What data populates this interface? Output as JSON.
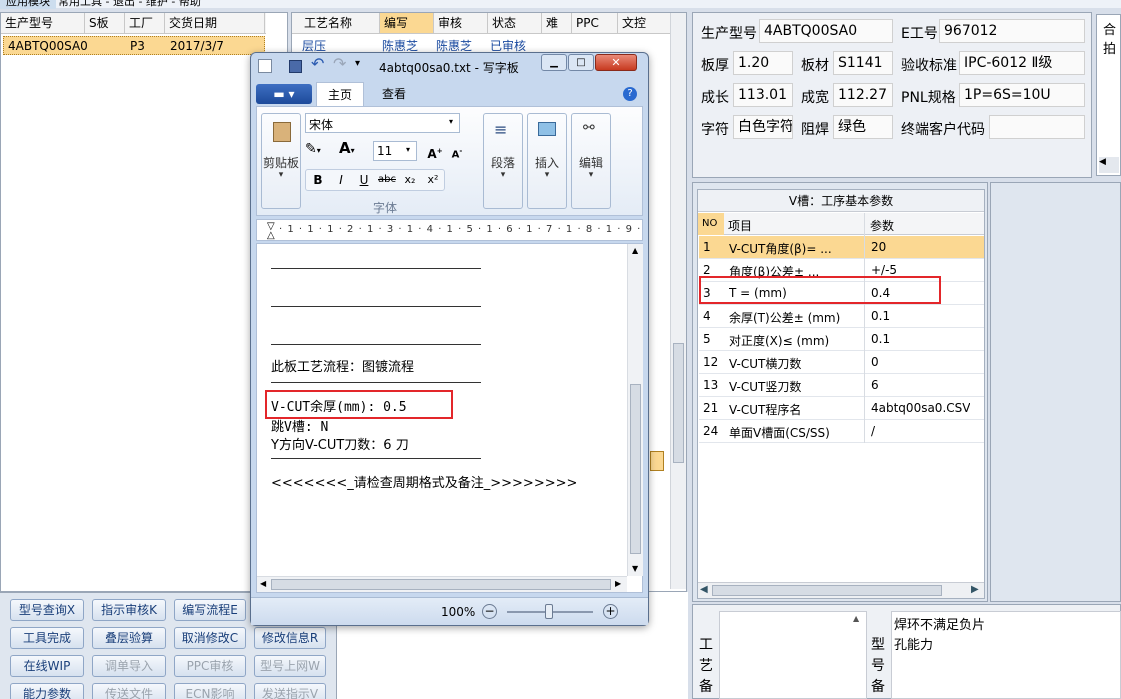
{
  "menubar": {
    "item1": "应用模块",
    "item2": "常用工具 - 退出 - 维护 - 帮助"
  },
  "left_list": {
    "headers": [
      "生产型号",
      "S板",
      "工厂",
      "交货日期"
    ],
    "row": {
      "model": "4ABTQ00SA0",
      "factory": "P3",
      "date": "2017/3/7"
    }
  },
  "middle_list": {
    "headers": [
      "工艺名称",
      "编写",
      "审核",
      "状态",
      "难",
      "PPC",
      "文控"
    ],
    "row": {
      "process": "层压",
      "writer": "陈惠芝",
      "auditor": "陈惠芝",
      "status": "已审核"
    }
  },
  "buttons": {
    "r1": [
      "型号查询X",
      "指示审核K",
      "编写流程E"
    ],
    "r2": [
      "工具完成",
      "叠层验算",
      "取消修改C",
      "修改信息R"
    ],
    "r3": [
      "在线WIP",
      "调单导入",
      "PPC审核",
      "型号上网W"
    ],
    "r4": [
      "能力参数",
      "传送文件",
      "ECN影响",
      "发送指示V"
    ]
  },
  "info": {
    "model_label": "生产型号",
    "model_value": "4ABTQ00SA0",
    "e_label": "E工号",
    "e_value": "967012",
    "thick_label": "板厚",
    "thick_value": "1.20",
    "material_label": "板材",
    "material_value": "S1141",
    "std_label": "验收标准",
    "std_value": "IPC-6012 Ⅱ级",
    "len_label": "成长",
    "len_value": "113.01",
    "wid_label": "成宽",
    "wid_value": "112.27",
    "pnl_label": "PNL规格",
    "pnl_value": "1P=6S=10U",
    "char_label": "字符",
    "char_value": "白色字符",
    "mask_label": "阻焊",
    "mask_value": "绿色",
    "cust_label": "终端客户代码",
    "cust_value": ""
  },
  "side_tab": "合拍",
  "vcut": {
    "title": "V槽：工序基本参数",
    "headers": [
      "NO",
      "项目",
      "参数"
    ],
    "rows": [
      {
        "no": "1",
        "item": "V-CUT角度(β)= ...",
        "val": "20"
      },
      {
        "no": "2",
        "item": "角度(β)公差± ...",
        "val": "+/-5"
      },
      {
        "no": "3",
        "item": "T = (mm)",
        "val": "0.4"
      },
      {
        "no": "4",
        "item": "余厚(T)公差± (mm)",
        "val": "0.1"
      },
      {
        "no": "5",
        "item": "对正度(X)≤ (mm)",
        "val": "0.1"
      },
      {
        "no": "12",
        "item": "V-CUT横刀数",
        "val": "0"
      },
      {
        "no": "13",
        "item": "V-CUT竖刀数",
        "val": "6"
      },
      {
        "no": "21",
        "item": "V-CUT程序名",
        "val": "4abtq00sa0.CSV"
      },
      {
        "no": "24",
        "item": "单面V槽面(CS/SS)",
        "val": "/"
      }
    ]
  },
  "bottom_left_label": "工\n艺\n备",
  "bottom_mid_label": "型\n号\n备",
  "bottom_note": "焊环不满足负片\n孔能力",
  "wordpad": {
    "title": "4abtq00sa0.txt - 写字板",
    "tab_home": "主页",
    "tab_view": "查看",
    "clipboard": "剪贴板",
    "font_name": "宋体",
    "font_size": "11",
    "font_group": "字体",
    "paragraph": "段落",
    "insert": "插入",
    "edit": "编辑",
    "ruler": "· 1 · 1 · 1 · 2 · 1 · 3 · 1 · 4 · 1 · 5 · 1 · 6 · 1 · 7 · 1 · 8 · 1 · 9 ·",
    "lines": {
      "flow": "此板工艺流程：图镀流程",
      "vcut": "V-CUT余厚(mm): 0.5",
      "skip": "跳V槽: N",
      "ycut": "Y方向V-CUT刀数：6 刀",
      "note": "<<<<<<<_请检查周期格式及备注_>>>>>>>>"
    },
    "zoom": "100%"
  }
}
